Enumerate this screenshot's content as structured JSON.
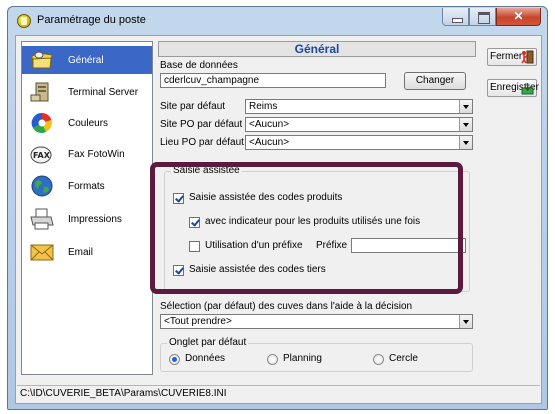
{
  "window": {
    "title": "Paramétrage du poste"
  },
  "sidebar": {
    "items": [
      {
        "label": "Général",
        "icon": "folder-icon"
      },
      {
        "label": "Terminal Server",
        "icon": "terminal-server-icon"
      },
      {
        "label": "Couleurs",
        "icon": "colors-icon"
      },
      {
        "label": "Fax FotoWin",
        "icon": "fax-icon"
      },
      {
        "label": "Formats",
        "icon": "globe-icon"
      },
      {
        "label": "Impressions",
        "icon": "printer-icon"
      },
      {
        "label": "Email",
        "icon": "envelope-icon"
      }
    ]
  },
  "panel": {
    "header": "Général",
    "db_label": "Base de données",
    "db_value": "cderlcuv_champagne",
    "change_label": "Changer",
    "site_label": "Site par défaut",
    "site_value": "Reims",
    "site_po_label": "Site PO par défaut",
    "site_po_value": "<Aucun>",
    "lieu_po_label": "Lieu PO par défaut",
    "lieu_po_value": "<Aucun>"
  },
  "assist": {
    "title": "Saisie assistée",
    "codes_produits": "Saisie assistée des codes produits",
    "indicateur": "avec indicateur pour les produits utilisés une fois",
    "prefixe_use": "Utilisation d'un préfixe",
    "prefixe_label": "Préfixe",
    "prefixe_value": "",
    "codes_tiers": "Saisie assistée des codes tiers"
  },
  "selection": {
    "label": "Sélection (par défaut) des cuves dans l'aide à la décision",
    "value": "<Tout prendre>"
  },
  "onglet": {
    "title": "Onglet par défaut",
    "options": [
      "Données",
      "Planning",
      "Cercle"
    ],
    "selected": "Données"
  },
  "actions": {
    "close": "Fermer",
    "save": "Enregistrer"
  },
  "status": {
    "path": "C:\\ID\\CUVERIE_BETA\\Params\\CUVERIE8.INI"
  },
  "colors": {
    "selection": "#3b68c6",
    "header_text": "#1a48a8",
    "highlight_border": "#5c1a3e"
  }
}
